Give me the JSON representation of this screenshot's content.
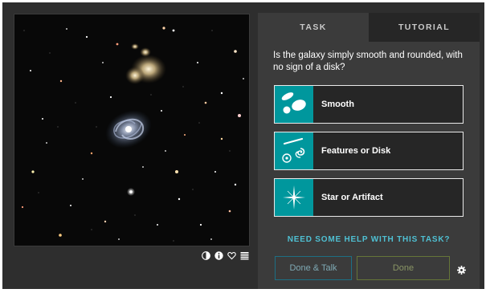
{
  "tabs": {
    "task": "TASK",
    "tutorial": "TUTORIAL"
  },
  "question": "Is the galaxy simply smooth and rounded, with no sign of a disk?",
  "answers": [
    {
      "label": "Smooth",
      "icon": "smooth-galaxy-icon"
    },
    {
      "label": "Features or Disk",
      "icon": "features-disk-icon"
    },
    {
      "label": "Star or Artifact",
      "icon": "star-artifact-icon"
    }
  ],
  "help_link": "NEED SOME HELP WITH THIS TASK?",
  "buttons": {
    "done_talk": "Done & Talk",
    "done": "Done"
  },
  "image_tools": [
    "invert-icon",
    "info-icon",
    "favorite-heart-icon",
    "collections-icon",
    "settings-gear-icon"
  ],
  "colors": {
    "background": "#2e2e2e",
    "panel": "#3b3b3b",
    "tab_inactive": "#262626",
    "answer_icon_bg": "#00979d",
    "help_link": "#4fc0d3",
    "done_talk_border": "#1d6f84",
    "done_border": "#657538"
  }
}
